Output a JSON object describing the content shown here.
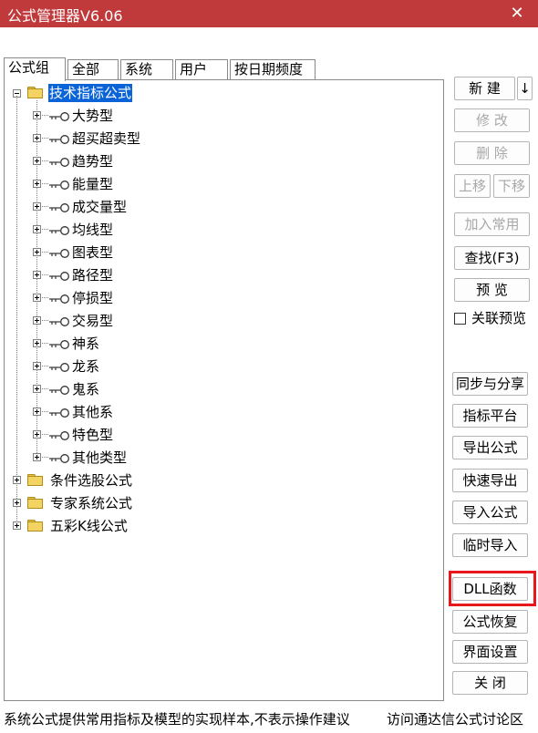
{
  "window": {
    "title": "公式管理器V6.06",
    "close_glyph": "✕"
  },
  "tabs": [
    {
      "label": "公式组"
    },
    {
      "label": "全部"
    },
    {
      "label": "系统"
    },
    {
      "label": "用户"
    },
    {
      "label": "按日期频度"
    }
  ],
  "tree": {
    "root": {
      "label": "技术指标公式",
      "expanded": true,
      "selected": true
    },
    "children": [
      "大势型",
      "超买超卖型",
      "趋势型",
      "能量型",
      "成交量型",
      "均线型",
      "图表型",
      "路径型",
      "停损型",
      "交易型",
      "神系",
      "龙系",
      "鬼系",
      "其他系",
      "特色型",
      "其他类型"
    ],
    "other_groups": [
      "条件选股公式",
      "专家系统公式",
      "五彩K线公式"
    ]
  },
  "buttons": {
    "new": "新 建",
    "new_arrow": "↓",
    "modify": "修 改",
    "delete": "删 除",
    "move_up": "上移",
    "move_down": "下移",
    "add_common": "加入常用",
    "find": "查找(F3)",
    "preview": "预 览",
    "linked_preview": "关联预览",
    "sync_share": "同步与分享",
    "indicator_platform": "指标平台",
    "export": "导出公式",
    "quick_export": "快速导出",
    "import": "导入公式",
    "temp_import": "临时导入",
    "dll": "DLL函数",
    "restore": "公式恢复",
    "ui_settings": "界面设置",
    "close": "关 闭"
  },
  "status": {
    "message": "系统公式提供常用指标及模型的实现样本,不表示操作建议",
    "link": "访问通达信公式讨论区"
  },
  "colors": {
    "titlebar": "#c0393b",
    "selection": "#0a64d8",
    "highlight_box": "#e8171c"
  }
}
